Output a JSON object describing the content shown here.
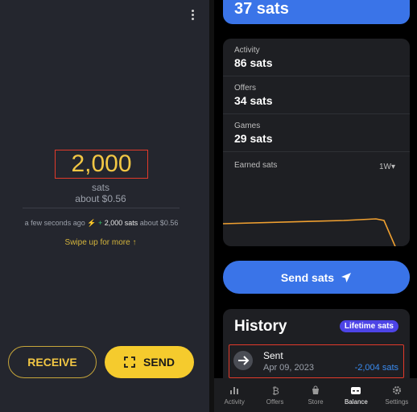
{
  "wallet": {
    "amount": "2,000",
    "unit": "sats",
    "fiat": "about $0.56",
    "tx_time": "a few seconds ago",
    "tx_plus": "+",
    "tx_amount": "2,000 sats",
    "tx_fiat": "about $0.56",
    "swipe_hint": "Swipe up for more",
    "receive_label": "RECEIVE",
    "send_label": "SEND"
  },
  "balance": {
    "total": "37 sats",
    "stats": [
      {
        "label": "Activity",
        "value": "86 sats"
      },
      {
        "label": "Offers",
        "value": "34 sats"
      },
      {
        "label": "Games",
        "value": "29 sats"
      }
    ],
    "earned_label": "Earned sats",
    "period": "1W",
    "send_sats_label": "Send sats",
    "history": {
      "title": "History",
      "badge": "Lifetime sats",
      "entry": {
        "name": "Sent",
        "date": "Apr 09, 2023",
        "amount": "-2,004 sats"
      }
    }
  },
  "nav": [
    {
      "label": "Activity",
      "icon": "bar-chart-icon"
    },
    {
      "label": "Offers",
      "icon": "bitcoin-icon"
    },
    {
      "label": "Store",
      "icon": "shopping-bag-icon"
    },
    {
      "label": "Balance",
      "icon": "wallet-icon",
      "active": true
    },
    {
      "label": "Settings",
      "icon": "gear-icon"
    }
  ],
  "colors": {
    "accent_yellow": "#f5cb2d",
    "accent_blue": "#3a74e8",
    "badge_purple": "#4d44e6",
    "highlight_red": "#e23a2a"
  }
}
